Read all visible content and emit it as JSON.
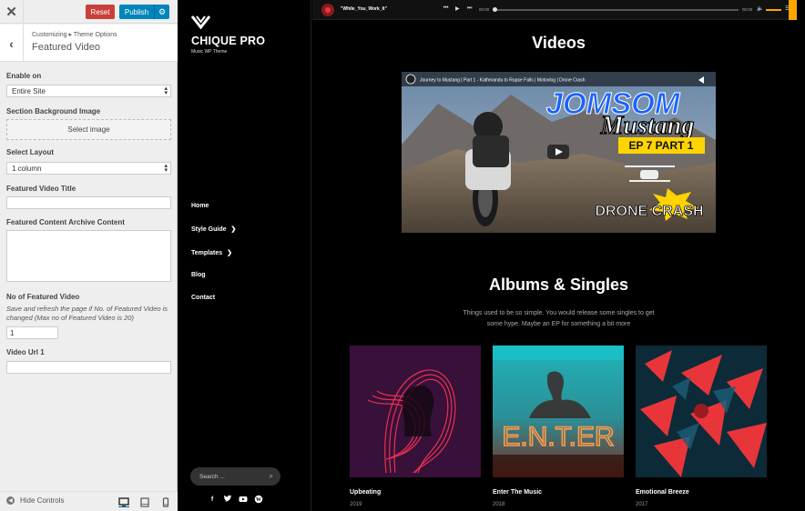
{
  "customizer": {
    "reset_label": "Reset",
    "publish_label": "Publish",
    "breadcrumb": "Customizing ▸ Theme Options",
    "section_title": "Featured Video",
    "fields": {
      "enable_on_label": "Enable on",
      "enable_on_value": "Entire Site",
      "bg_image_label": "Section Background Image",
      "select_image_label": "Select image",
      "layout_label": "Select Layout",
      "layout_value": "1 column",
      "video_title_label": "Featured Video Title",
      "video_title_value": "",
      "archive_label": "Featured Content Archive Content",
      "archive_value": "",
      "count_label": "No of Featured Video",
      "count_note": "Save and refresh the page if No. of Featured Video is changed (Max no of Featured Video is 20)",
      "count_value": "1",
      "url_label": "Video Url 1",
      "url_value": ""
    },
    "footer": {
      "hide_controls_label": "Hide Controls"
    }
  },
  "site": {
    "title": "CHIQUE PRO",
    "tagline": "Music WP Theme",
    "menu": [
      {
        "label": "Home",
        "has_submenu": false
      },
      {
        "label": "Style Guide",
        "has_submenu": true
      },
      {
        "label": "Templates",
        "has_submenu": true
      },
      {
        "label": "Blog",
        "has_submenu": false
      },
      {
        "label": "Contact",
        "has_submenu": false
      }
    ],
    "search_placeholder": "Search ...",
    "social_icons": [
      "facebook-icon",
      "twitter-icon",
      "youtube-icon",
      "wordpress-icon"
    ]
  },
  "player": {
    "track": "\"While_You_Work_It\"",
    "time_elapsed": "00:00",
    "time_total": "00:00",
    "accent_color": "#ffa500"
  },
  "videos": {
    "heading": "Videos",
    "video_title": "Journey to Mustang | Part 1 - Kathmandu to Rupse Falls | Motovlog | Drone Crash",
    "thumb_text_1": "JOMSOM",
    "thumb_text_2": "Mustang",
    "thumb_badge": "EP 7 PART 1",
    "thumb_text_3": "DRONE CRASH"
  },
  "albums": {
    "heading": "Albums & Singles",
    "intro": "Things used to be so simple. You would release some singles to get some hype. Maybe an EP for something a bit more",
    "items": [
      {
        "title": "Upbeating",
        "year": "2019"
      },
      {
        "title": "Enter The Music",
        "year": "2018",
        "cover_text": "E.N.T.ER"
      },
      {
        "title": "Emotional Breeze",
        "year": "2017"
      }
    ]
  }
}
